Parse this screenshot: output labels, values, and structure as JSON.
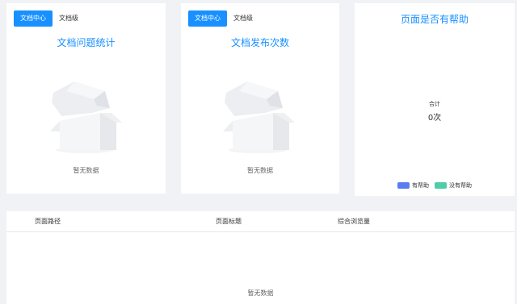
{
  "cards": {
    "issue_stats": {
      "tabs": [
        "文档中心",
        "文档级"
      ],
      "title": "文档问题统计",
      "empty_text": "暂无数据"
    },
    "publish_count": {
      "tabs": [
        "文档中心",
        "文档级"
      ],
      "title": "文档发布次数",
      "empty_text": "暂无数据"
    },
    "helpful": {
      "title": "页面是否有帮助",
      "total_label": "合计",
      "total_value": "0次",
      "legend": [
        {
          "label": "有帮助",
          "color": "#5b7cf0"
        },
        {
          "label": "没有帮助",
          "color": "#4fcca8"
        }
      ]
    }
  },
  "table": {
    "columns": [
      "页面路径",
      "页面标题",
      "综合浏览量"
    ],
    "empty_text": "暂无数据"
  },
  "colors": {
    "accent": "#1890ff",
    "background": "#f0f2f5"
  }
}
